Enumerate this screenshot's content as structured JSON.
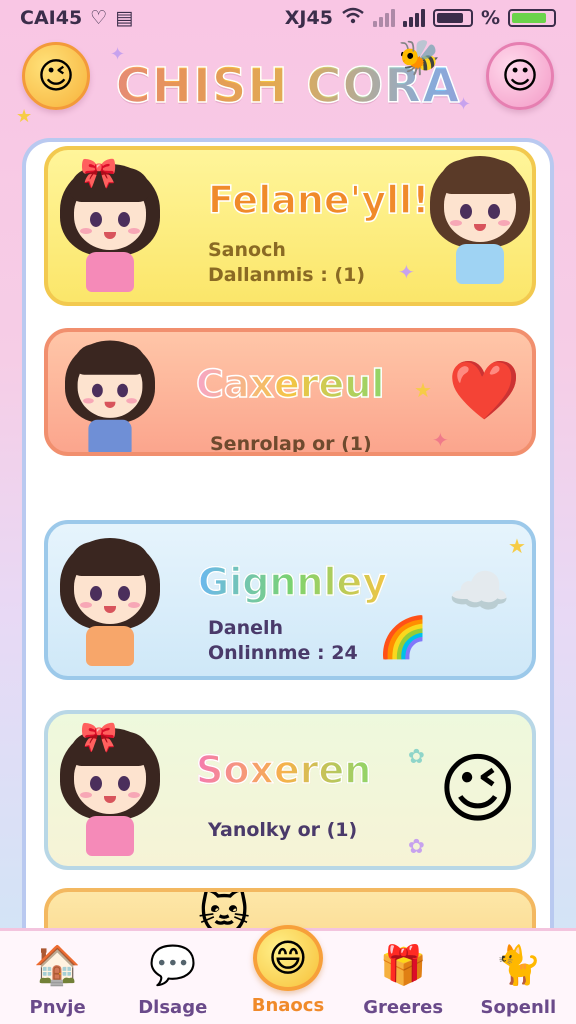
{
  "status_bar": {
    "left_text": "CAI45",
    "right_text": "XJ45",
    "percent": "%"
  },
  "app": {
    "title": "CHISH CORA"
  },
  "cards": [
    {
      "title": "Felane'yll!",
      "line1": "Sanoch",
      "line2": "Dallanmis : (1)"
    },
    {
      "title": "Caxereul",
      "line1": "Senrolap or (1)"
    },
    {
      "title": "Gignnley",
      "line1": "Danelh",
      "line2": "Onlinnme : 24"
    },
    {
      "title": "Soxeren",
      "line1": "Yanolky or (1)"
    }
  ],
  "nav": [
    {
      "label": "Pnvje",
      "icon": "house-icon"
    },
    {
      "label": "Dlsage",
      "icon": "bubble-icon"
    },
    {
      "label": "Bnaocs",
      "icon": "smiley-icon",
      "active": true
    },
    {
      "label": "Greeres",
      "icon": "gift-box-icon"
    },
    {
      "label": "Sopenll",
      "icon": "cat-icon"
    }
  ],
  "colors": {
    "background_top": "#f9c6e4",
    "accent_orange": "#f08a2a",
    "accent_pink": "#f58ab8",
    "battery_green": "#6bd34b"
  }
}
